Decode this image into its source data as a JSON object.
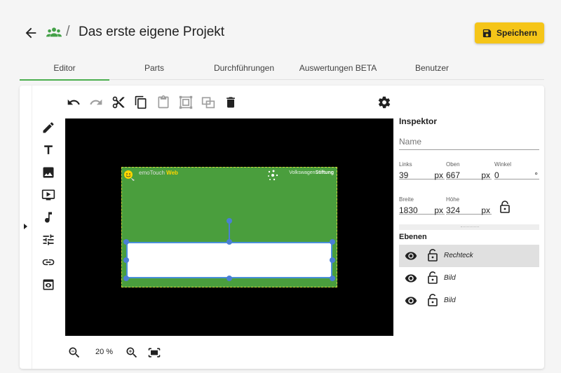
{
  "header": {
    "title": "Das erste eigene Projekt",
    "separator": "/",
    "save_label": "Speichern",
    "accent_color": "#f5c518"
  },
  "tabs": [
    {
      "label": "Editor",
      "active": true
    },
    {
      "label": "Parts",
      "active": false
    },
    {
      "label": "Durchführungen",
      "active": false
    },
    {
      "label": "Auswertungen BETA",
      "active": false
    },
    {
      "label": "Benutzer",
      "active": false
    }
  ],
  "toolbar": {
    "icons": [
      "undo-icon",
      "redo-icon",
      "cut-icon",
      "copy-icon",
      "paste-icon",
      "group-icon",
      "ungroup-icon",
      "delete-icon",
      "settings-icon"
    ]
  },
  "side_tools": [
    "pencil-icon",
    "text-icon",
    "image-icon",
    "video-icon",
    "music-icon",
    "sliders-icon",
    "link-icon",
    "preview-icon"
  ],
  "canvas": {
    "background": "#000000",
    "slide_color": "#4a9e3d",
    "logo_left_prefix": "emoTouch",
    "logo_left_suffix": "Web",
    "logo_right_prefix": "Volkswagen",
    "logo_right_suffix": "Stiftung"
  },
  "zoom": {
    "value": "20 %"
  },
  "inspector": {
    "title": "Inspektor",
    "name_placeholder": "Name",
    "links": {
      "label": "Links",
      "value": "39",
      "unit": "px"
    },
    "oben": {
      "label": "Oben",
      "value": "667",
      "unit": "px"
    },
    "winkel": {
      "label": "Winkel",
      "value": "0",
      "unit": "°"
    },
    "breite": {
      "label": "Breite",
      "value": "1830",
      "unit": "px"
    },
    "hoehe": {
      "label": "Höhe",
      "value": "324",
      "unit": "px"
    }
  },
  "layers": {
    "title": "Ebenen",
    "items": [
      {
        "name": "Rechteck",
        "selected": true
      },
      {
        "name": "Bild",
        "selected": false
      },
      {
        "name": "Bild",
        "selected": false
      }
    ]
  }
}
